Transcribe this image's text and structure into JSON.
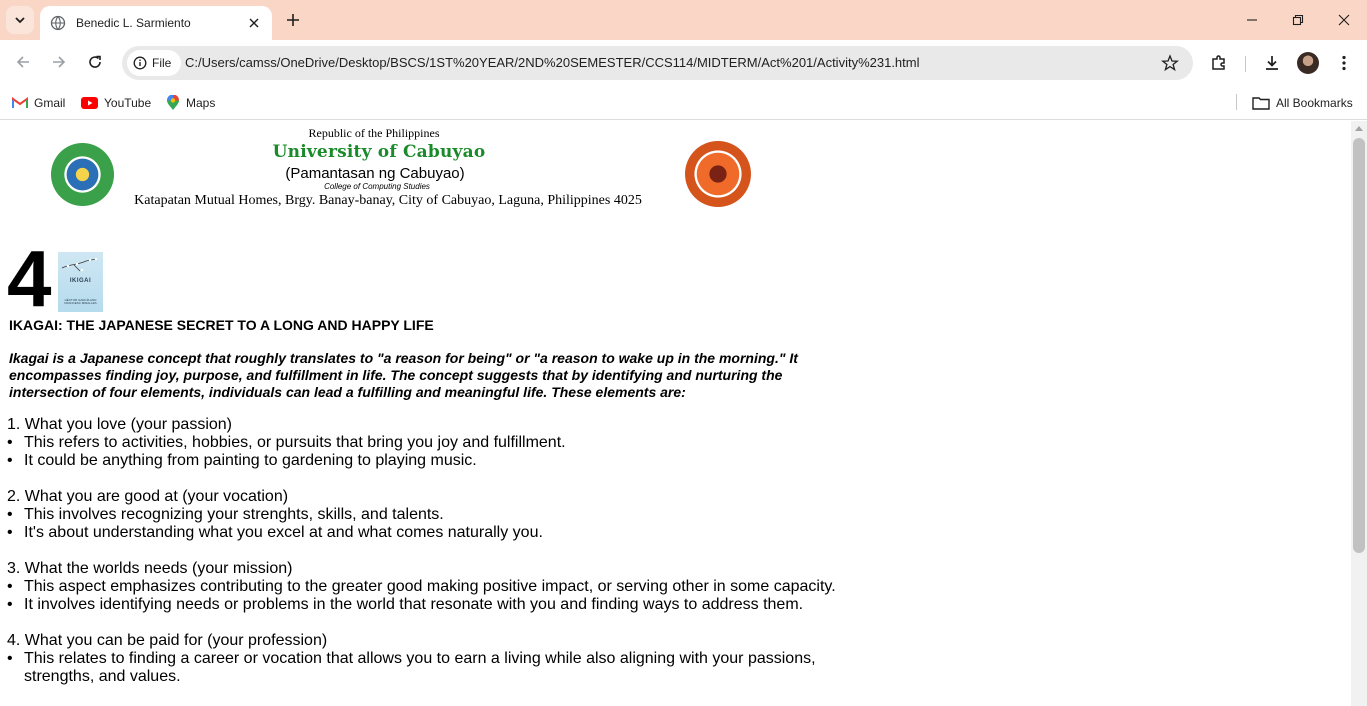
{
  "browser": {
    "tab_title": "Benedic L. Sarmiento",
    "security_chip": "File",
    "url": "C:/Users/camss/OneDrive/Desktop/BSCS/1ST%20YEAR/2ND%20SEMESTER/CCS114/MIDTERM/Act%201/Activity%231.html",
    "bookmarks": [
      "Gmail",
      "YouTube",
      "Maps"
    ],
    "all_bookmarks": "All Bookmarks"
  },
  "header": {
    "republic": "Republic of the Philippines",
    "university": "University of Cabuyao",
    "pamantasan": "(Pamantasan ng Cabuyao)",
    "college": "College of Computing Studies",
    "address": "Katapatan Mutual Homes, Brgy. Banay-banay, City of Cabuyao, Laguna, Philippines 4025"
  },
  "content": {
    "number": "4",
    "image_word": "IKIGAI",
    "image_sub": "HÉCTOR GARCÍA AND FRANCESC MIRALLES",
    "heading": "IKAGAI: THE JAPANESE SECRET TO A LONG AND HAPPY LIFE",
    "intro": "Ikagai is a Japanese concept that roughly translates to \"a reason for being\" or \"a reason to wake up in the morning.\" It encompasses finding joy, purpose, and fulfillment in life. The concept suggests that by identifying and nurturing the intersection of four elements, individuals can lead a fulfilling and meaningful life. These elements are:",
    "sections": [
      {
        "title": "1. What you love (your passion)",
        "bullets": [
          "This refers to activities, hobbies, or pursuits that bring you joy and fulfillment.",
          "It could be anything from painting to gardening to playing music."
        ]
      },
      {
        "title": "2. What you are good at (your vocation)",
        "bullets": [
          "This involves recognizing your strenghts, skills, and talents.",
          "It's about understanding what you excel at and what comes naturally you."
        ]
      },
      {
        "title": "3. What the worlds needs (your mission)",
        "bullets": [
          "This aspect emphasizes contributing to the greater good making positive impact, or serving other in some capacity.",
          "It involves identifying needs or problems in the world that resonate with you and finding ways to address them."
        ]
      },
      {
        "title": "4. What you can be paid for (your profession)",
        "bullets": [
          "This relates to finding a career or vocation that allows you to earn a living while also aligning with your passions, strengths, and values."
        ]
      }
    ]
  }
}
